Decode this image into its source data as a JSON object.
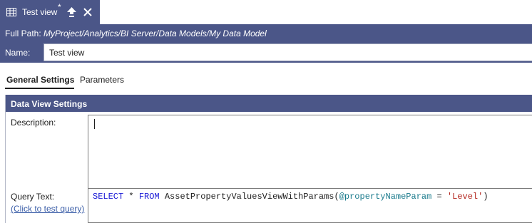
{
  "tab": {
    "title": "Test view",
    "dirty_marker": "*",
    "icon": "table-icon",
    "pin_icon": "pin-up-arrow-icon",
    "close_icon": "close-icon"
  },
  "header": {
    "full_path_label": "Full Path:",
    "full_path_value": "MyProject/Analytics/BI Server/Data Models/My Data Model",
    "name_label": "Name:",
    "name_value": "Test view"
  },
  "settings_tabs": [
    {
      "label": "General Settings",
      "active": true
    },
    {
      "label": "Parameters",
      "active": false
    }
  ],
  "section": {
    "title": "Data View Settings",
    "description_label": "Description:",
    "description_value": "",
    "query_label": "Query Text:",
    "query_link": "(Click to test query)",
    "query": {
      "kw_select": "SELECT",
      "star": " * ",
      "kw_from": "FROM",
      "func": " AssetPropertyValuesViewWithParams(",
      "param": "@propertyNameParam",
      "eq": " = ",
      "str": "'Level'",
      "close": ")"
    }
  },
  "colors": {
    "header_bg": "#4b5688",
    "link": "#3b5ea8",
    "sql_keyword": "#1a1ad6",
    "sql_param": "#1a7a8c",
    "sql_string": "#b3261e"
  }
}
